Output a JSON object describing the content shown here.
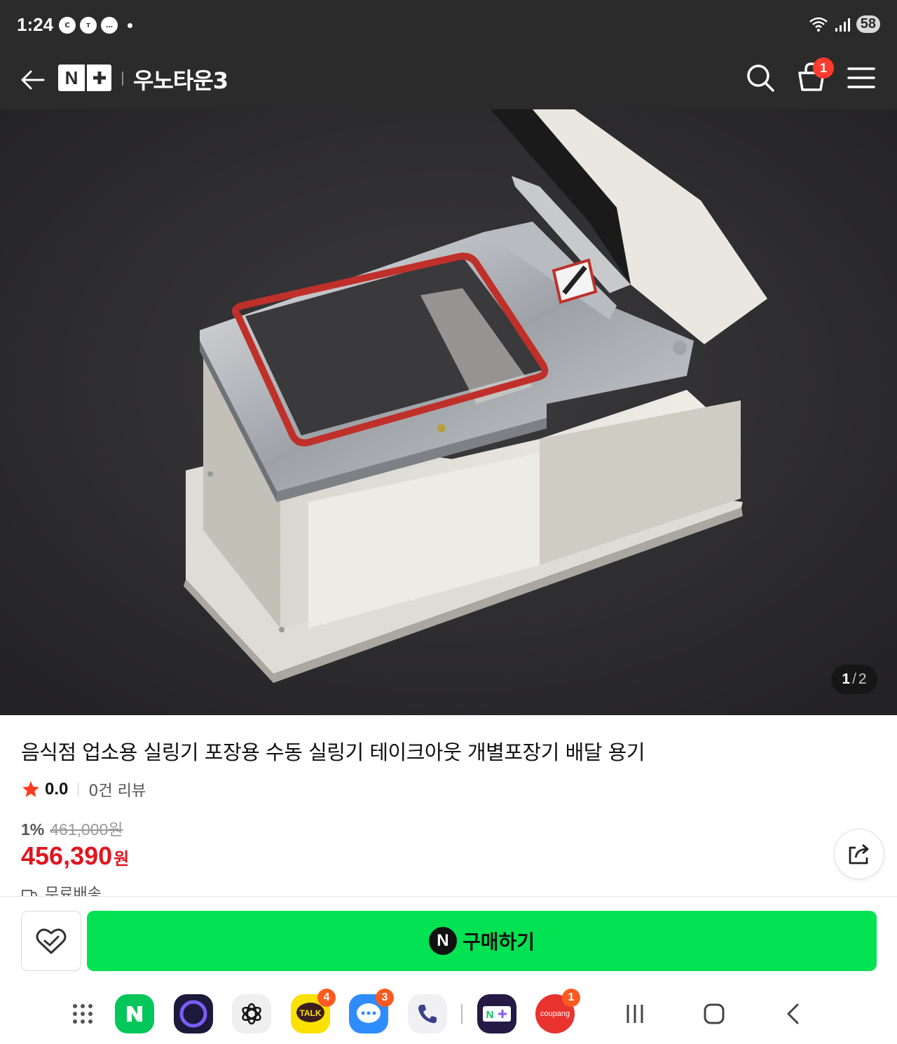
{
  "status_bar": {
    "time": "1:24",
    "notification_icons": [
      "c-icon",
      "talk-icon",
      "chat-bubble-icon"
    ],
    "battery": "58"
  },
  "header": {
    "logo_letter": "N",
    "store_name": "우노타운3",
    "cart_count": "1"
  },
  "gallery": {
    "current": "1",
    "separator": "/",
    "total": "2"
  },
  "product": {
    "title": "음식점 업소용 실링기 포장용 수동 실링기 테이크아웃 개별포장기 배달 용기",
    "rating": "0.0",
    "review_count": "0건 리뷰",
    "discount_rate": "1%",
    "original_price": "461,000원",
    "sale_price": "456,390",
    "currency": "원",
    "shipping": "무료배송"
  },
  "actions": {
    "buy_label": "구매하기",
    "buy_icon_letter": "N"
  },
  "dock": {
    "apps": [
      {
        "name": "naver",
        "badge": ""
      },
      {
        "name": "samsung-internet",
        "badge": ""
      },
      {
        "name": "chatgpt",
        "badge": ""
      },
      {
        "name": "kakaotalk",
        "label": "TALK",
        "badge": "4"
      },
      {
        "name": "messages",
        "badge": "3"
      },
      {
        "name": "phone",
        "badge": ""
      },
      {
        "name": "naver-plus-store",
        "badge": ""
      },
      {
        "name": "coupang",
        "label": "coupang",
        "badge": "1"
      }
    ]
  },
  "colors": {
    "header_bg": "#2b2b2b",
    "buy_green": "#03e253",
    "price_red": "#e0151f",
    "star": "#ff3b1f"
  }
}
